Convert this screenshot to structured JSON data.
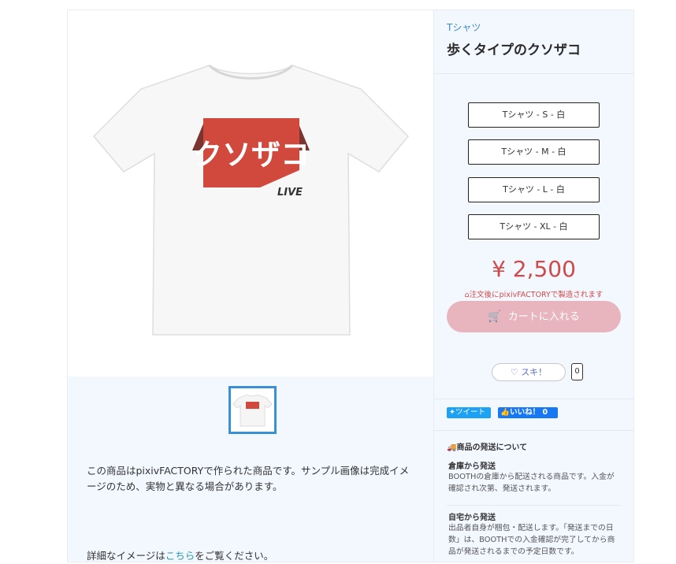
{
  "product": {
    "category": "Tシャツ",
    "title": "歩くタイプのクソザコ",
    "shirt_text": "クソザコ",
    "shirt_sub": "LIVE",
    "price": "¥ 2,500",
    "factory_notice": "注文後にpixivFACTORYで製造されます",
    "cart_label": "カートに入れる",
    "like_label": "スキ！",
    "like_count": "0",
    "variants": [
      "Tシャツ - S - 白",
      "Tシャツ - M - 白",
      "Tシャツ - L - 白",
      "Tシャツ - XL - 白"
    ]
  },
  "social": {
    "tweet": "ツイート",
    "fb_like": "いいね！ 0"
  },
  "description": {
    "text": "この商品はpixivFACTORYで作られた商品です。サンプル画像は完成イメージのため、実物と異なる場合があります。",
    "detail_prefix": "詳細なイメージは",
    "detail_link": "こちら",
    "detail_suffix": "をご覧ください。"
  },
  "shipping": {
    "heading": "商品の発送について",
    "warehouse_title": "倉庫から発送",
    "warehouse_body": "BOOTHの倉庫から配送される商品です。入金が確認され次第、発送されます。",
    "self_title": "自宅から発送",
    "self_body": "出品者自身が梱包・配送します。「発送までの日数」は、BOOTHでの入金確認が完了してから商品が発送されるまでの予定日数です。"
  },
  "colors": {
    "accent": "#3b8fd4",
    "price": "#d04a4a",
    "cart": "#e8b4bd",
    "shirt_logo": "#d1483c"
  }
}
